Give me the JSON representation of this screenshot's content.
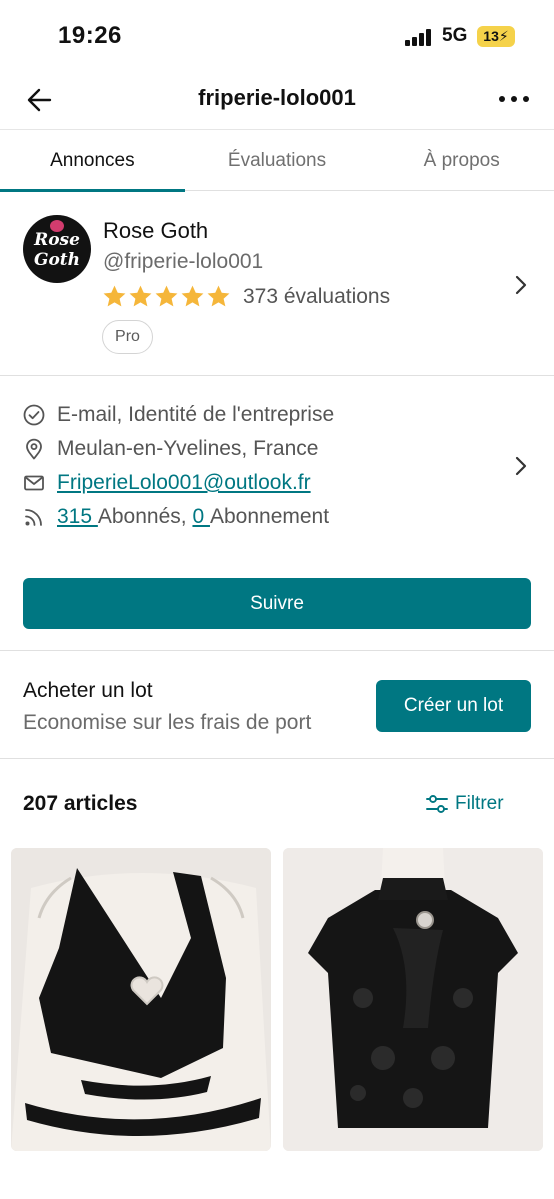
{
  "status_bar": {
    "time": "19:26",
    "network": "5G",
    "battery": "13"
  },
  "nav": {
    "title": "friperie-lolo001"
  },
  "tabs": [
    {
      "label": "Annonces",
      "active": true
    },
    {
      "label": "Évaluations",
      "active": false
    },
    {
      "label": "À propos",
      "active": false
    }
  ],
  "profile": {
    "avatar_text_line1": "Rose",
    "avatar_text_line2": "Goth",
    "name": "Rose Goth",
    "handle": "@friperie-lolo001",
    "rating_stars": 5,
    "reviews": "373 évaluations",
    "badge": "Pro"
  },
  "info": {
    "verified": "E-mail, Identité de l'entreprise",
    "location": "Meulan-en-Yvelines, France",
    "email": "FriperieLolo001@outlook.fr",
    "followers_count": "315 ",
    "followers_label": "Abonnés, ",
    "following_count": "0 ",
    "following_label": "Abonnement"
  },
  "follow_button": "Suivre",
  "bundle": {
    "title": "Acheter un lot",
    "subtitle": "Economise sur les frais de port",
    "button": "Créer un lot"
  },
  "articles": {
    "count_label": "207 articles",
    "filter_label": "Filtrer"
  },
  "colors": {
    "accent": "#007782",
    "star": "#f5b63a"
  }
}
